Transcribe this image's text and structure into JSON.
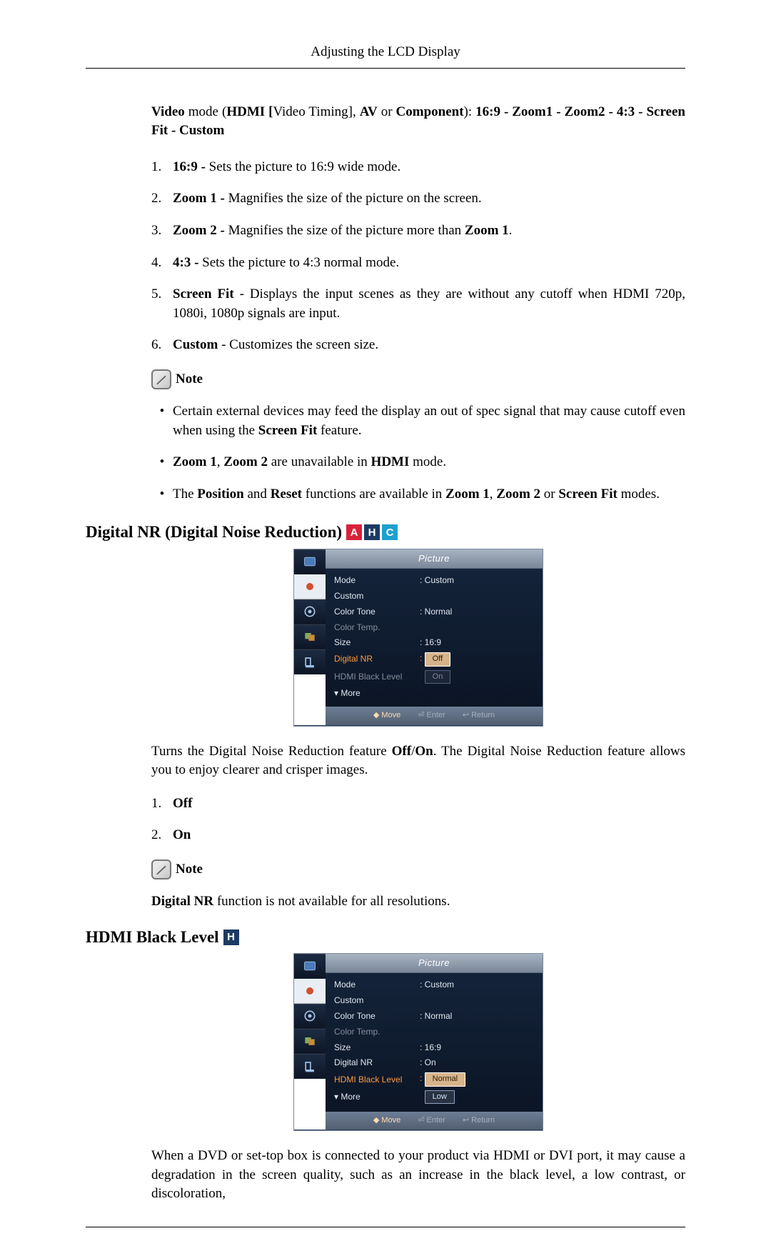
{
  "header": {
    "title": "Adjusting the LCD Display"
  },
  "intro": {
    "prefix_bold": "Video",
    "t1": " mode (",
    "b1": "HDMI [",
    "t2": "Video Timing], ",
    "b2": "AV",
    "t3": " or ",
    "b3": "Component",
    "t4": "): ",
    "opts": "16:9 - Zoom1 - Zoom2 - 4:3 - Screen Fit - Custom"
  },
  "list1": [
    {
      "n": "1.",
      "b": "16:9 - ",
      "t": "Sets the picture to 16:9 wide mode."
    },
    {
      "n": "2.",
      "b": "Zoom 1 - ",
      "t": "Magnifies the size of the picture on the screen."
    },
    {
      "n": "3.",
      "b": "Zoom 2 - ",
      "t1": "Magnifies the size of the picture more than ",
      "b2": "Zoom 1",
      "t2": "."
    },
    {
      "n": "4.",
      "b": "4:3 -",
      "t": " Sets the picture to 4:3 normal mode."
    },
    {
      "n": "5.",
      "b": "Screen Fit",
      "t": " - Displays the input scenes as they are without any cutoff when HDMI 720p, 1080i, 1080p signals are input."
    },
    {
      "n": "6.",
      "b": "Custom",
      "t": " - Customizes the screen size."
    }
  ],
  "note_label": "Note",
  "note1_items": [
    {
      "pre": "Certain external devices may feed the display an out of spec signal that may cause cutoff even when using the ",
      "b": "Screen Fit",
      "post": " feature."
    },
    {
      "b0": "Zoom 1",
      "m0": ", ",
      "b1": "Zoom 2",
      "m1": " are unavailable in ",
      "b2": "HDMI",
      "m2": " mode."
    },
    {
      "pre": "The ",
      "b0": "Position",
      "m0": " and ",
      "b1": "Reset",
      "m1": " functions are available in  ",
      "b2": "Zoom 1",
      "m2": ",  ",
      "b3": "Zoom 2",
      "m3": " or ",
      "b4": "Screen Fit",
      "m4": " modes."
    }
  ],
  "section1": {
    "title": "Digital NR (Digital Noise Reduction)",
    "badges": [
      "A",
      "H",
      "C"
    ]
  },
  "osd1": {
    "title": "Picture",
    "rows": {
      "mode_k": "Mode",
      "mode_v": ": Custom",
      "custom_k": "Custom",
      "colortone_k": "Color Tone",
      "colortone_v": ": Normal",
      "colortemp_k": "Color Temp.",
      "size_k": "Size",
      "size_v": ": 16:9",
      "dnr_k": "Digital NR",
      "dnr_opt_off": "Off",
      "dnr_prefix": ": ",
      "hbl_k": "HDMI Black Level",
      "hbl_opt_on": "On",
      "more_k": "▾ More"
    },
    "hints": {
      "move": "◆ Move",
      "enter": "⏎ Enter",
      "ret": "↩ Return"
    }
  },
  "desc1": {
    "pre": "Turns the Digital Noise Reduction feature ",
    "b0": "Off",
    "m0": "/",
    "b1": "On",
    "post": ". The Digital Noise Reduction feature allows you to enjoy clearer and crisper images."
  },
  "list2": [
    {
      "n": "1.",
      "b": "Off"
    },
    {
      "n": "2.",
      "b": "On"
    }
  ],
  "note2": {
    "b0": "Digital NR",
    "t": " function is not available for all resolutions."
  },
  "section2": {
    "title": "HDMI Black Level",
    "badges": [
      "H"
    ]
  },
  "osd2": {
    "title": "Picture",
    "rows": {
      "mode_k": "Mode",
      "mode_v": ": Custom",
      "custom_k": "Custom",
      "colortone_k": "Color Tone",
      "colortone_v": ": Normal",
      "colortemp_k": "Color Temp.",
      "size_k": "Size",
      "size_v": ": 16:9",
      "dnr_k": "Digital NR",
      "dnr_v": ": On",
      "hbl_k": "HDMI Black Level",
      "hbl_opt_normal": "Normal",
      "hbl_opt_low": "Low",
      "hbl_prefix": ": ",
      "more_k": "▾ More"
    },
    "hints": {
      "move": "◆ Move",
      "enter": "⏎ Enter",
      "ret": "↩ Return"
    }
  },
  "desc2": "When a DVD or set-top box is connected to your product via HDMI or DVI port, it may cause a degradation in the screen quality, such as an increase in the black level, a low contrast, or discoloration,"
}
